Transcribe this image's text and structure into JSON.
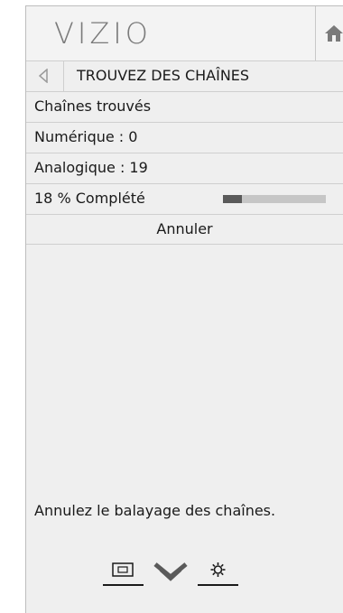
{
  "header": {
    "logo": "VIZIO",
    "home_icon": "home-icon"
  },
  "titlebar": {
    "back_icon": "back-arrow-icon",
    "title": "TROUVEZ DES CHAÎNES"
  },
  "rows": {
    "found_label": "Chaînes trouvés",
    "digital": "Numérique : 0",
    "analog": "Analogique : 19",
    "progress_text": "18 % Complété",
    "progress_fraction": 0.18,
    "cancel_label": "Annuler"
  },
  "help_text": "Annulez le balayage des chaînes.",
  "bottom_nav": {
    "input_icon": "input-icon",
    "down_icon": "chevron-down-icon",
    "settings_icon": "gear-icon"
  },
  "colors": {
    "panel_bg": "#efefef",
    "progress_fill": "#5a5a5a",
    "progress_track": "#c6c6c6",
    "logo": "#7a7a7a"
  }
}
